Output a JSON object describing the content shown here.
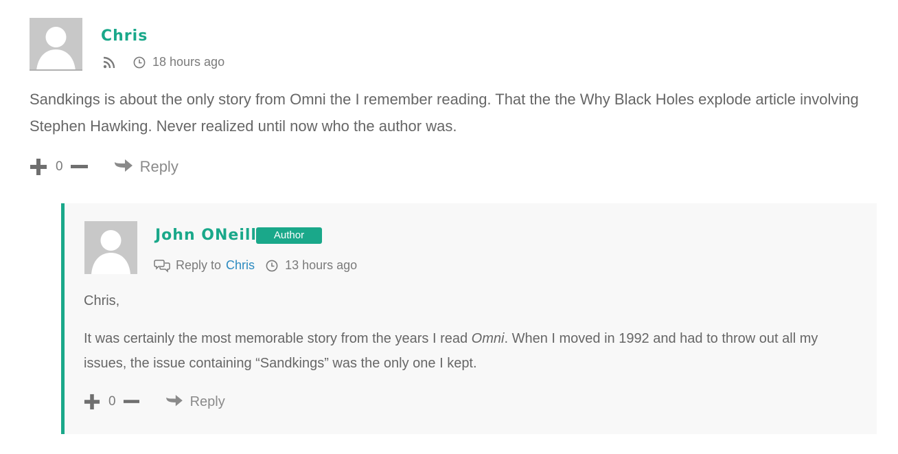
{
  "comments": [
    {
      "author": "Chris",
      "time": "18 hours ago",
      "text": "Sandkings is about the only story from Omni the I remember reading. That the the Why Black Holes explode article involving Stephen Hawking. Never realized until now who the author was.",
      "votes": "0",
      "reply_label": "Reply"
    }
  ],
  "reply": {
    "author": "John ONeill",
    "badge": "Author",
    "reply_to_prefix": "Reply to",
    "reply_to_name": "Chris",
    "time": "13 hours ago",
    "greeting": "Chris,",
    "text_before": "It was certainly the most memorable story from the years I read ",
    "text_italic": "Omni",
    "text_after": ". When I moved in 1992 and had to throw out all my issues, the issue containing “Sandkings” was the only one I kept.",
    "votes": "0",
    "reply_label": "Reply"
  },
  "colors": {
    "accent": "#1aa88a",
    "link": "#2b8ac0",
    "text": "#666666",
    "reply_bg": "#f8f8f8"
  },
  "icons": {
    "feed": "rss-icon",
    "clock": "clock-icon",
    "upvote": "plus-icon",
    "downvote": "minus-icon",
    "reply": "reply-arrow-icon",
    "replyto": "speech-bubbles-icon"
  }
}
